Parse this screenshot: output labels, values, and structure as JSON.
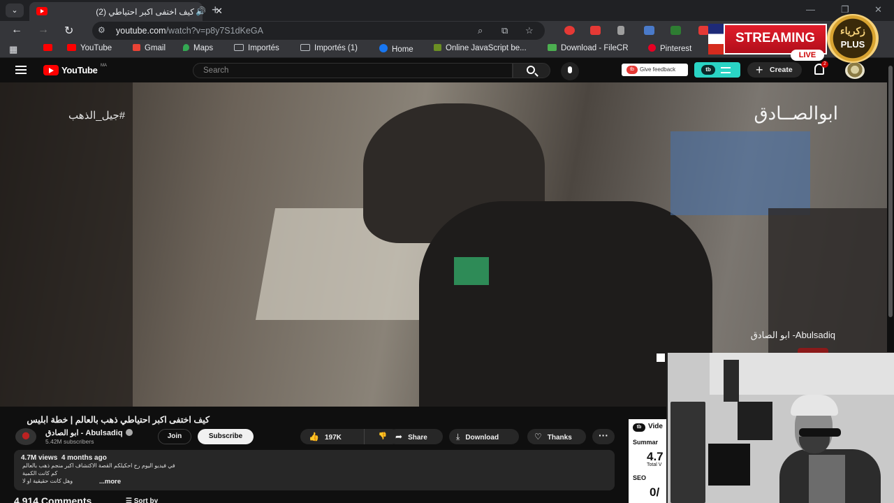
{
  "browser": {
    "tab_title": "كيف اختفى اكبر احتياطي (2)",
    "tab_audio_icon": "speaker-icon",
    "url_domain": "youtube.com",
    "url_path": "/watch?v=p8y7S1dKeGA"
  },
  "bookmarks": [
    {
      "label": "YouTube",
      "icon": "youtube-icon",
      "color": "#ff0000"
    },
    {
      "label": "Gmail",
      "icon": "gmail-icon",
      "color": "#ea4335"
    },
    {
      "label": "Maps",
      "icon": "maps-icon",
      "color": "#34a853"
    },
    {
      "label": "Importés",
      "icon": "folder-icon"
    },
    {
      "label": "Importés (1)",
      "icon": "folder-icon"
    },
    {
      "label": "Home",
      "icon": "facebook-icon",
      "color": "#1877f2"
    },
    {
      "label": "Online JavaScript be...",
      "icon": "shield-icon",
      "color": "#6b8e23"
    },
    {
      "label": "Download - FileCR",
      "icon": "filecr-icon",
      "color": "#4caf50"
    },
    {
      "label": "Pinterest",
      "icon": "pinterest-icon",
      "color": "#e60023"
    }
  ],
  "bookmarks_overflow": "ts",
  "youtube": {
    "wordmark": "YouTube",
    "country": "MA",
    "search_placeholder": "Search",
    "feedback_label": "Give feedback",
    "create_label": "Create",
    "notifications_count": "2"
  },
  "overlays": {
    "streaming_label": "STREAMING",
    "live_label": "LIVE",
    "plus_arabic": "زكرياء",
    "plus_label": "PLUS"
  },
  "video_overlay": {
    "hashtag": "#جيل_الذهب",
    "watermark": "ابوالصــادق",
    "credit": "ابو الصادق -Abulsadiq"
  },
  "video": {
    "title": "كيف اختفى اكبر احتياطي ذهب بالعالم | خطة ابليس",
    "channel_name": "ابو الصادق - Abulsadiq",
    "subscribers": "5.42M subscribers",
    "join_label": "Join",
    "subscribe_label": "Subscribe",
    "likes": "197K",
    "share_label": "Share",
    "download_label": "Download",
    "thanks_label": "Thanks",
    "views": "4.7M views",
    "age": "4 months ago",
    "desc_line1": "في فيديو اليوم رح احكيلكم القصة الاكتشاف اكبر منجم ذهب بالعالم",
    "desc_line2": "كم كانت الكمية",
    "desc_line3": "وهل كانت حقيقية او لا",
    "more_label": "...more",
    "comments_count": "4,914 Comments",
    "sort_label": "Sort by"
  },
  "side_panel": {
    "header": "Vide",
    "tab": "Summar",
    "value1": "4.7",
    "value1_label": "Total V",
    "seo_label": "SEO",
    "value2": "0/"
  }
}
